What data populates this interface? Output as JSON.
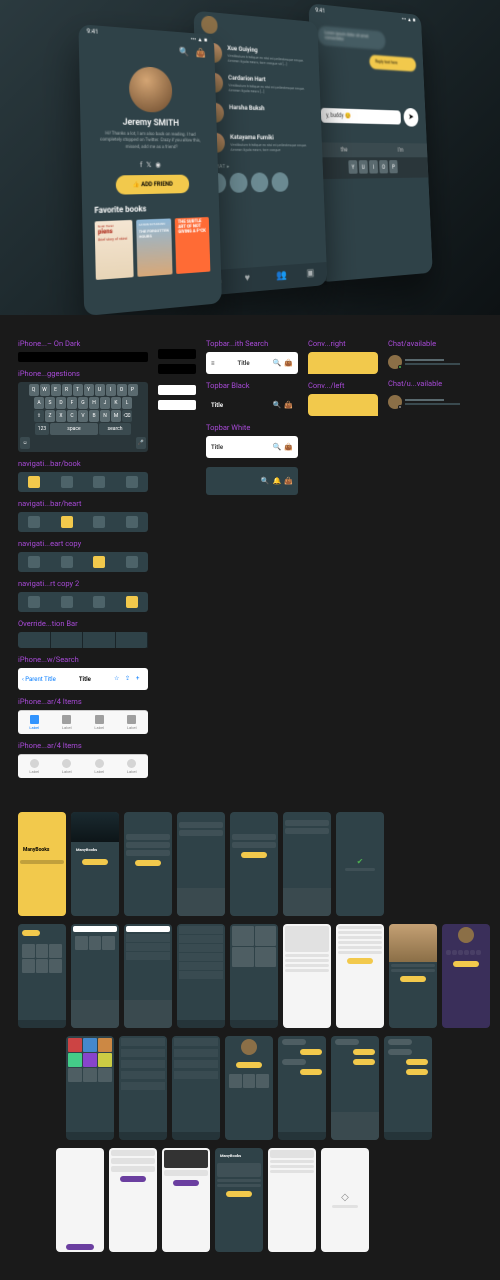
{
  "hero": {
    "status_time": "9:41",
    "screen1": {
      "name": "Jeremy SMITH",
      "bio": "Hi! Thanks a lot, I am also back on reading. I had completely stopped on Twitter. Crazy if you allow this, missed, add me as a friend?",
      "button": "ADD FRIEND",
      "section": "Favorite books",
      "books": [
        {
          "title": "piens",
          "subtitle": "Brief story of nkind",
          "author": "Noah Harari"
        },
        {
          "title": "THE FORGOTTEN HOURS",
          "author": "KATRIN SCHUMANN"
        },
        {
          "title": "THE SUBTLE ART OF NOT GIVING A F*CK"
        }
      ]
    },
    "screen2": {
      "contacts": [
        {
          "name": "Xue Guiying",
          "msg": "Vestibulum tristique ex nisi mi pellentesque neque. Aenean ligula easm, tore congue sit [...]"
        },
        {
          "name": "Cardarion Hart",
          "msg": "Vestibulum tristique ex nisi mi pellentesque neque. Aenean ligula easm [...]"
        },
        {
          "name": "Harsha Buksh",
          "msg": ""
        },
        {
          "name": "Katayama Fumiki",
          "msg": "Vestibulum tristique ex nisi mi pellentesque neque. Aenean ligula easm, tore congue"
        }
      ],
      "chat_label": "Y CHAT ▸"
    },
    "screen3": {
      "input_value": "y, buddy 😊",
      "suggestions": [
        "the",
        "I'm"
      ],
      "keys_row": [
        "Y",
        "U",
        "I",
        "O",
        "P"
      ]
    }
  },
  "components": {
    "col1": [
      "iPhone...– On Dark",
      "iPhone...ggestions",
      "navigati...bar/book",
      "navigati...bar/heart",
      "navigati...eart copy",
      "navigati...rt copy 2",
      "Override...tion Bar",
      "iPhone...w/Search",
      "iPhone...ar/4 Items",
      "iPhone...ar/4 Items"
    ],
    "kbd_keys": {
      "row1": [
        "Q",
        "W",
        "E",
        "R",
        "T",
        "Y",
        "U",
        "I",
        "O",
        "P"
      ],
      "row2": [
        "A",
        "S",
        "D",
        "F",
        "G",
        "H",
        "J",
        "K",
        "L"
      ],
      "row3": [
        "Z",
        "X",
        "C",
        "V",
        "B",
        "N",
        "M"
      ],
      "space": "space",
      "search": "search"
    },
    "ios_nav": {
      "back": "‹ Parent Title",
      "title": "Title"
    },
    "ios_tabs": [
      "Label",
      "Label",
      "Label",
      "Label"
    ],
    "col3": [
      "Topbar...ith Search",
      "Topbar Black",
      "Topbar White"
    ],
    "topbar_title": "Title",
    "col4": [
      "Conv...right",
      "Conv.../left"
    ],
    "col5": [
      "Chat/available",
      "Chat/u...vailable"
    ]
  },
  "app_grid": {
    "brand": "ManyBooks"
  }
}
